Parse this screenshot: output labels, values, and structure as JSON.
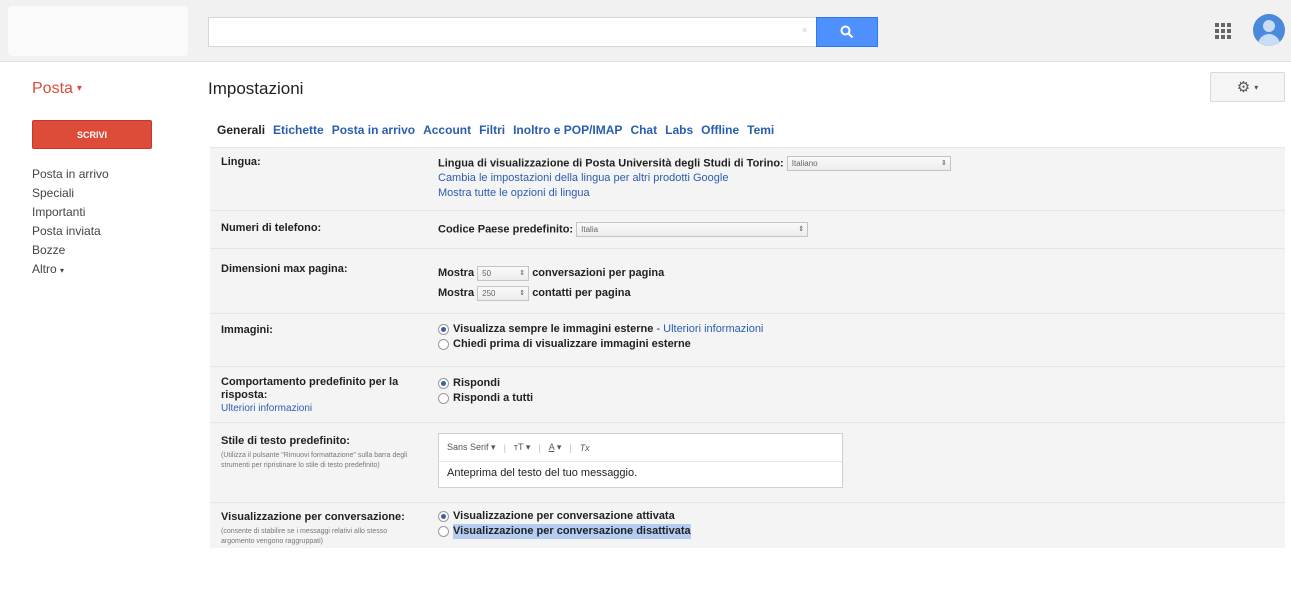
{
  "search": {
    "value": "",
    "clear_glyph": "×"
  },
  "header": {
    "app_menu": "Posta",
    "page_title": "Impostazioni"
  },
  "sidebar": {
    "compose": "SCRIVI",
    "items": [
      "Posta in arrivo",
      "Speciali",
      "Importanti",
      "Posta inviata",
      "Bozze",
      "Altro"
    ]
  },
  "tabs": [
    "Generali",
    "Etichette",
    "Posta in arrivo",
    "Account",
    "Filtri",
    "Inoltro e POP/IMAP",
    "Chat",
    "Labs",
    "Offline",
    "Temi"
  ],
  "settings": {
    "language": {
      "label": "Lingua:",
      "text": "Lingua di visualizzazione di Posta Università degli Studi di Torino:",
      "selected": "Italiano",
      "link1": "Cambia le impostazioni della lingua per altri prodotti Google",
      "link2": "Mostra tutte le opzioni di lingua"
    },
    "phone": {
      "label": "Numeri di telefono:",
      "text": "Codice Paese predefinito:",
      "selected": "Italia"
    },
    "page_size": {
      "label": "Dimensioni max pagina:",
      "show": "Mostra",
      "conv_value": "50",
      "conv_text": "conversazioni per pagina",
      "contacts_value": "250",
      "contacts_text": "contatti per pagina"
    },
    "images": {
      "label": "Immagini:",
      "opt1": "Visualizza sempre le immagini esterne",
      "sep": " - ",
      "opt1_link": "Ulteriori informazioni",
      "opt2": "Chiedi prima di visualizzare immagini esterne"
    },
    "reply": {
      "label": "Comportamento predefinito per la risposta:",
      "link": "Ulteriori informazioni",
      "opt1": "Rispondi",
      "opt2": "Rispondi a tutti"
    },
    "text_style": {
      "label": "Stile di testo predefinito:",
      "hint": "(Utilizza il pulsante \"Rimuovi formattazione\" sulla barra degli strumenti per ripristinare lo stile di testo predefinito)",
      "font": "Sans Serif",
      "size_glyph": "тT",
      "color_glyph": "A",
      "clear_glyph": "Tx",
      "preview": "Anteprima del testo del tuo messaggio."
    },
    "conversation": {
      "label": "Visualizzazione per conversazione:",
      "hint": "(consente di stabilire se i messaggi relativi allo stesso argomento vengono raggruppati)",
      "opt1": "Visualizzazione per conversazione attivata",
      "opt2": "Visualizzazione per conversazione disattivata"
    }
  },
  "colors": {
    "accent_red": "#dd4b39",
    "link_blue": "#2a5db0",
    "search_blue": "#4d90fe"
  }
}
